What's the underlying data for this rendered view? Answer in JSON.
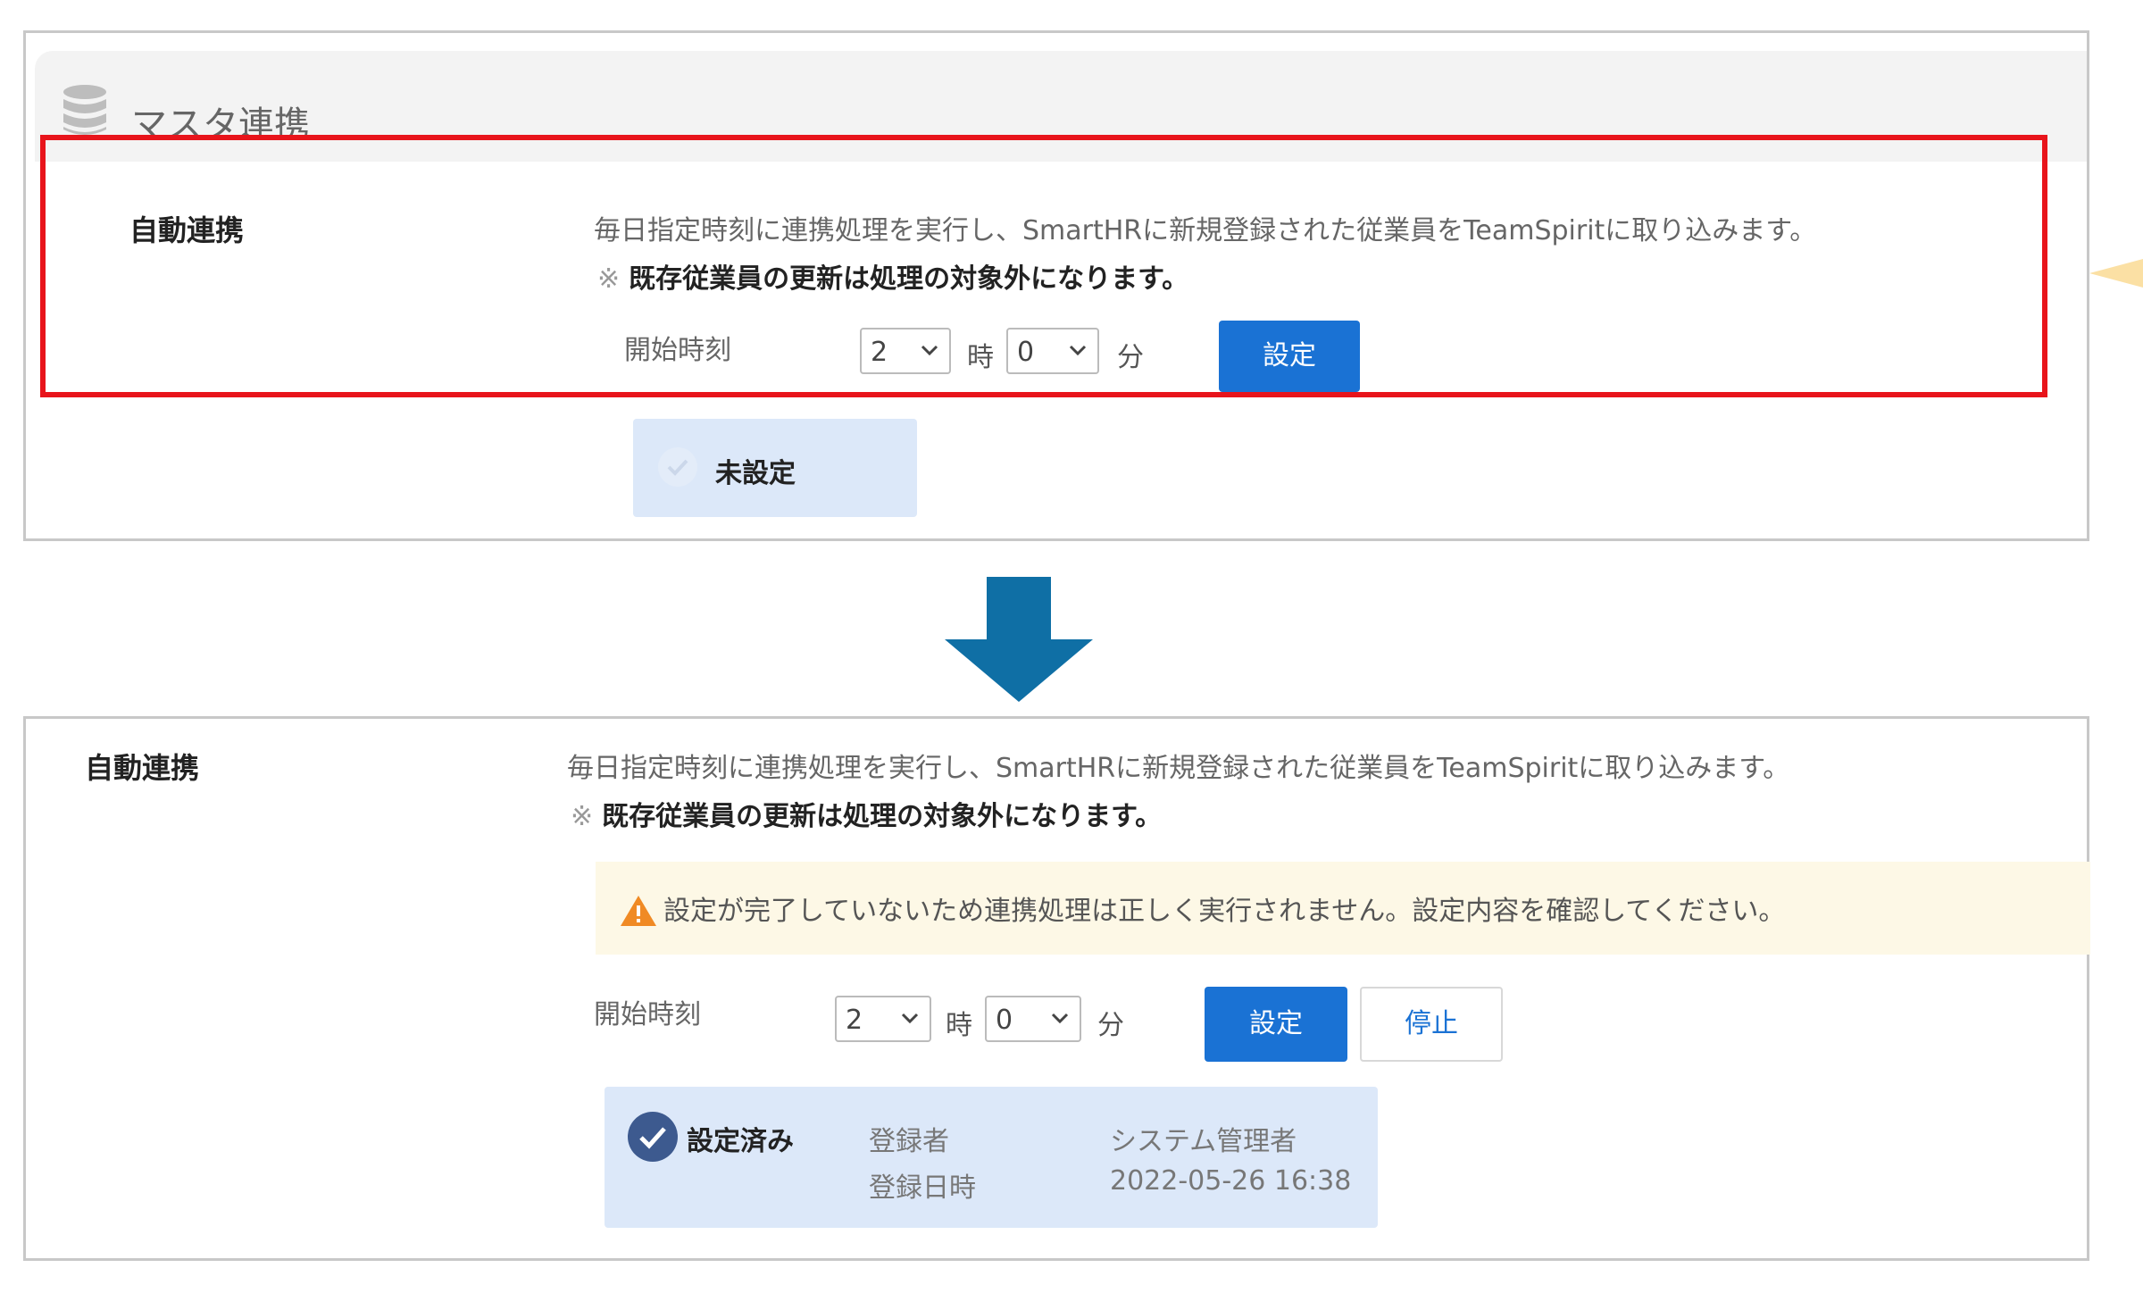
{
  "colors": {
    "primary": "#1a72d4",
    "highlight_border": "#e8141b",
    "arrow": "#0f6fa5",
    "status_bg": "#dce8f9",
    "warning_bg": "#fdf8e6",
    "warning_icon": "#f08a24"
  },
  "before": {
    "header": {
      "icon": "database-icon",
      "title": "マスタ連携"
    },
    "section_label": "自動連携",
    "description": "毎日指定時刻に連携処理を実行し、SmartHRに新規登録された従業員をTeamSpiritに取り込みます。",
    "note_mark": "※",
    "note": "既存従業員の更新は処理の対象外になります。",
    "start_time_label": "開始時刻",
    "hour_value": "2",
    "hour_unit": "時",
    "minute_value": "0",
    "minute_unit": "分",
    "set_button": "設定",
    "status": {
      "icon": "check-circle-icon",
      "text": "未設定"
    }
  },
  "after": {
    "section_label": "自動連携",
    "description": "毎日指定時刻に連携処理を実行し、SmartHRに新規登録された従業員をTeamSpiritに取り込みます。",
    "note_mark": "※",
    "note": "既存従業員の更新は処理の対象外になります。",
    "warning": {
      "icon": "warning-icon",
      "text": "設定が完了していないため連携処理は正しく実行されません。設定内容を確認してください。"
    },
    "start_time_label": "開始時刻",
    "hour_value": "2",
    "hour_unit": "時",
    "minute_value": "0",
    "minute_unit": "分",
    "set_button": "設定",
    "stop_button": "停止",
    "status": {
      "icon": "check-circle-icon",
      "text": "設定済み",
      "registrant_label": "登録者",
      "registrant_value": "システム管理者",
      "registered_at_label": "登録日時",
      "registered_at_value": "2022-05-26 16:38"
    }
  }
}
